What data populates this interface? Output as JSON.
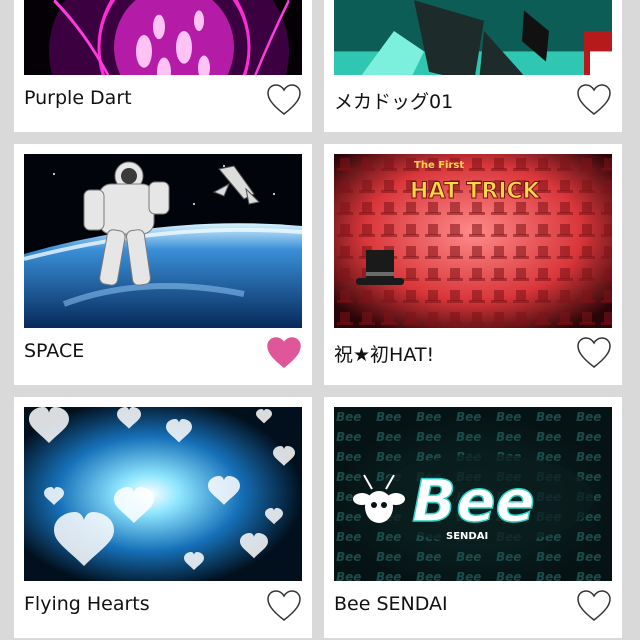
{
  "cards": [
    {
      "title": "Purple Dart",
      "favorited": false,
      "thumbnail_icon": "purple-dart-thumbnail"
    },
    {
      "title": "メカドッグ01",
      "favorited": false,
      "thumbnail_icon": "mecha-dog-thumbnail"
    },
    {
      "title": "SPACE",
      "favorited": true,
      "thumbnail_icon": "space-astronaut-thumbnail"
    },
    {
      "title": "祝★初HAT!",
      "favorited": false,
      "thumbnail_icon": "hat-trick-thumbnail",
      "thumbnail_text": [
        "The First",
        "HAT TRICK"
      ]
    },
    {
      "title": "Flying Hearts",
      "favorited": false,
      "thumbnail_icon": "flying-hearts-thumbnail"
    },
    {
      "title": "Bee SENDAI",
      "favorited": false,
      "thumbnail_icon": "bee-sendai-thumbnail",
      "thumbnail_text": [
        "Bee",
        "SENDAI"
      ]
    }
  ],
  "colors": {
    "background": "#d9d9d9",
    "card": "#ffffff",
    "favorite_active": "#e0569a",
    "favorite_inactive_stroke": "#333333"
  }
}
